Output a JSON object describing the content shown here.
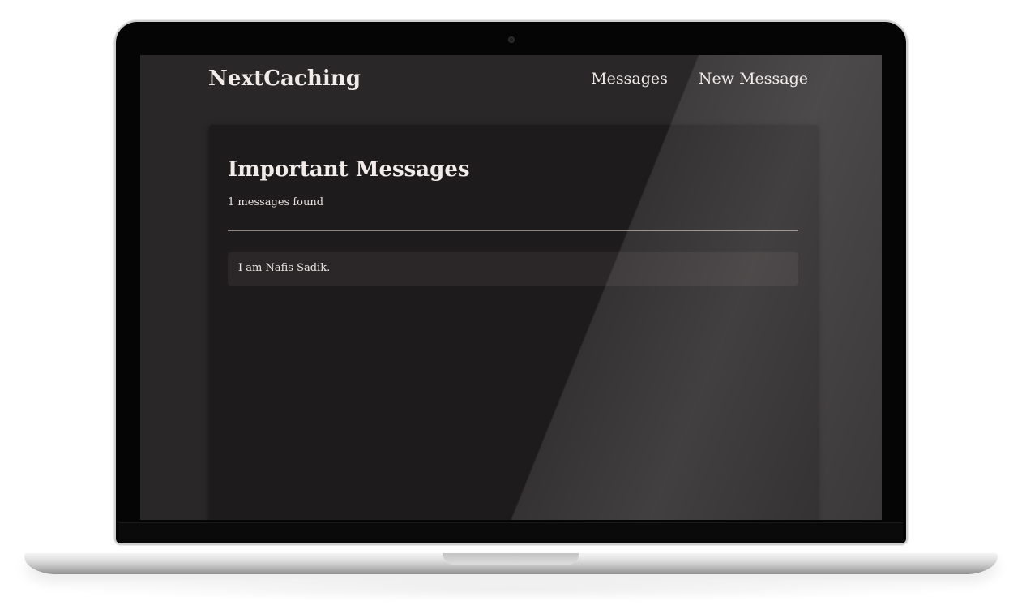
{
  "header": {
    "logo": "NextCaching",
    "nav": [
      {
        "label": "Messages"
      },
      {
        "label": "New Message"
      }
    ]
  },
  "main": {
    "title": "Important Messages",
    "count_text": "1 messages found",
    "messages": [
      {
        "text": "I am Nafis Sadik."
      }
    ]
  },
  "colors": {
    "screen_bg": "#2a2728",
    "card_bg": "#1e1b1c",
    "text": "#f1ecea"
  }
}
